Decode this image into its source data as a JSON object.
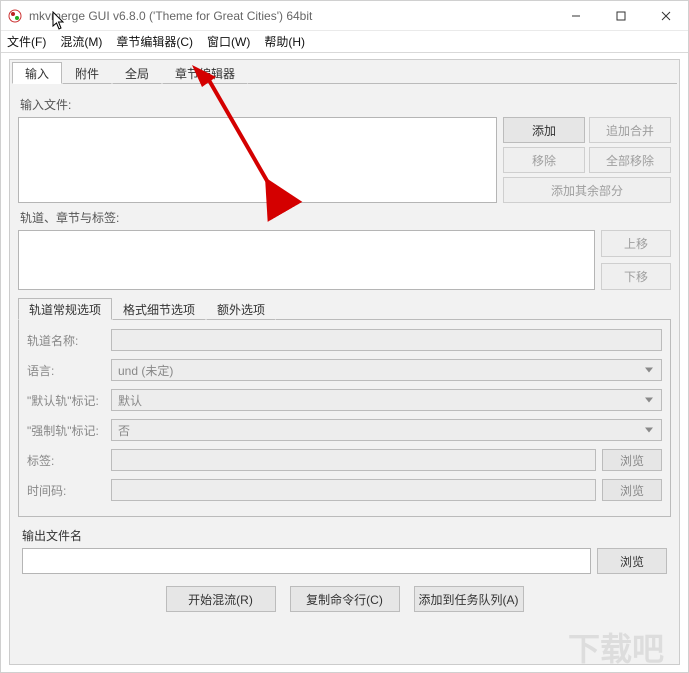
{
  "window": {
    "title": "mkvmerge GUI v6.8.0 ('Theme for Great Cities') 64bit"
  },
  "menu": {
    "file": "文件(F)",
    "mux": "混流(M)",
    "chapter_editor": "章节编辑器(C)",
    "window": "窗口(W)",
    "help": "帮助(H)"
  },
  "tabs": {
    "input": "输入",
    "attachments": "附件",
    "global": "全局",
    "chapter_editor": "章节编辑器"
  },
  "input": {
    "input_files_label": "输入文件:",
    "add": "添加",
    "append": "追加合并",
    "remove": "移除",
    "remove_all": "全部移除",
    "add_parts": "添加其余部分",
    "tracks_label": "轨道、章节与标签:",
    "up": "上移",
    "down": "下移"
  },
  "subtabs": {
    "general": "轨道常规选项",
    "format": "格式细节选项",
    "extra": "额外选项"
  },
  "form": {
    "track_name_label": "轨道名称:",
    "language_label": "语言:",
    "language_value": "und (未定)",
    "default_track_label": "\"默认轨\"标记:",
    "default_track_value": "默认",
    "forced_track_label": "\"强制轨\"标记:",
    "forced_track_value": "否",
    "tags_label": "标签:",
    "browse": "浏览",
    "timecodes_label": "时间码:"
  },
  "output": {
    "label": "输出文件名",
    "browse": "浏览"
  },
  "footer": {
    "start": "开始混流(R)",
    "copycmd": "复制命令行(C)",
    "addqueue": "添加到任务队列(A)"
  }
}
